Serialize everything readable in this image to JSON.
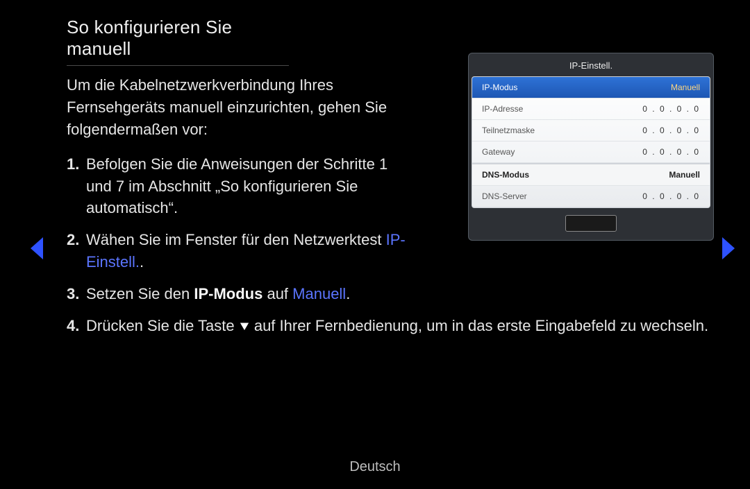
{
  "heading": "So konfigurieren Sie manuell",
  "intro": "Um die Kabelnetzwerkverbindung Ihres Fernsehgeräts manuell einzurichten, gehen Sie folgendermaßen vor:",
  "steps": {
    "s1": {
      "num": "1.",
      "text": "Befolgen Sie die Anweisungen der Schritte 1 und 7 im Abschnitt „So konfigurieren Sie automatisch“."
    },
    "s2": {
      "num": "2.",
      "pre": "Wähen Sie im Fenster für den Netzwerktest ",
      "link": "IP-Einstell.",
      "post": "."
    },
    "s3": {
      "num": "3.",
      "pre": "Setzen Sie den ",
      "k1": "IP-Modus",
      "mid": " auf ",
      "k2": "Manuell",
      "post": "."
    },
    "s4": {
      "num": "4.",
      "pre": "Drücken Sie die Taste ",
      "post": " auf Ihrer Fernbedienung, um in das erste Eingabefeld zu wechseln."
    }
  },
  "panel": {
    "title": "IP-Einstell.",
    "rows": {
      "ipmode": {
        "label": "IP-Modus",
        "value": "Manuell"
      },
      "ip": {
        "label": "IP-Adresse",
        "value": "0 . 0 . 0 . 0"
      },
      "mask": {
        "label": "Teilnetzmaske",
        "value": "0 . 0 . 0 . 0"
      },
      "gw": {
        "label": "Gateway",
        "value": "0 . 0 . 0 . 0"
      },
      "dnsmode": {
        "label": "DNS-Modus",
        "value": "Manuell"
      },
      "dns": {
        "label": "DNS-Server",
        "value": "0 . 0 . 0 . 0"
      }
    }
  },
  "footer": "Deutsch"
}
